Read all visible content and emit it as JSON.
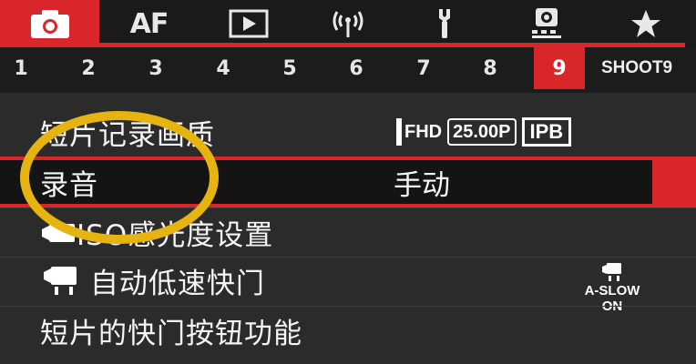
{
  "tabs": [
    {
      "name": "camera",
      "label": "",
      "active": true
    },
    {
      "name": "af",
      "label": "AF",
      "active": false
    },
    {
      "name": "playback",
      "label": "",
      "active": false
    },
    {
      "name": "wireless",
      "label": "",
      "active": false
    },
    {
      "name": "setup",
      "label": "",
      "active": false
    },
    {
      "name": "custom",
      "label": "",
      "active": false
    },
    {
      "name": "mymenu",
      "label": "",
      "active": false
    }
  ],
  "pages": [
    "1",
    "2",
    "3",
    "4",
    "5",
    "6",
    "7",
    "8",
    "9"
  ],
  "active_page": "9",
  "shoot_label": "SHOOT9",
  "menu": {
    "row1": {
      "label": "短片记录画质",
      "fhd": "FHD",
      "fps": "25.00P",
      "codec": "IPB"
    },
    "row2": {
      "label": "录音",
      "value": "手动"
    },
    "row3": {
      "label": "ISO感光度设置"
    },
    "row4": {
      "label": "自动低速快门",
      "badge": "A-SLOW ON"
    },
    "row5": {
      "label": "短片的快门按钮功能"
    }
  },
  "colors": {
    "accent": "#d8262b",
    "annotation": "#e5b411",
    "background": "#2b2b2b"
  }
}
